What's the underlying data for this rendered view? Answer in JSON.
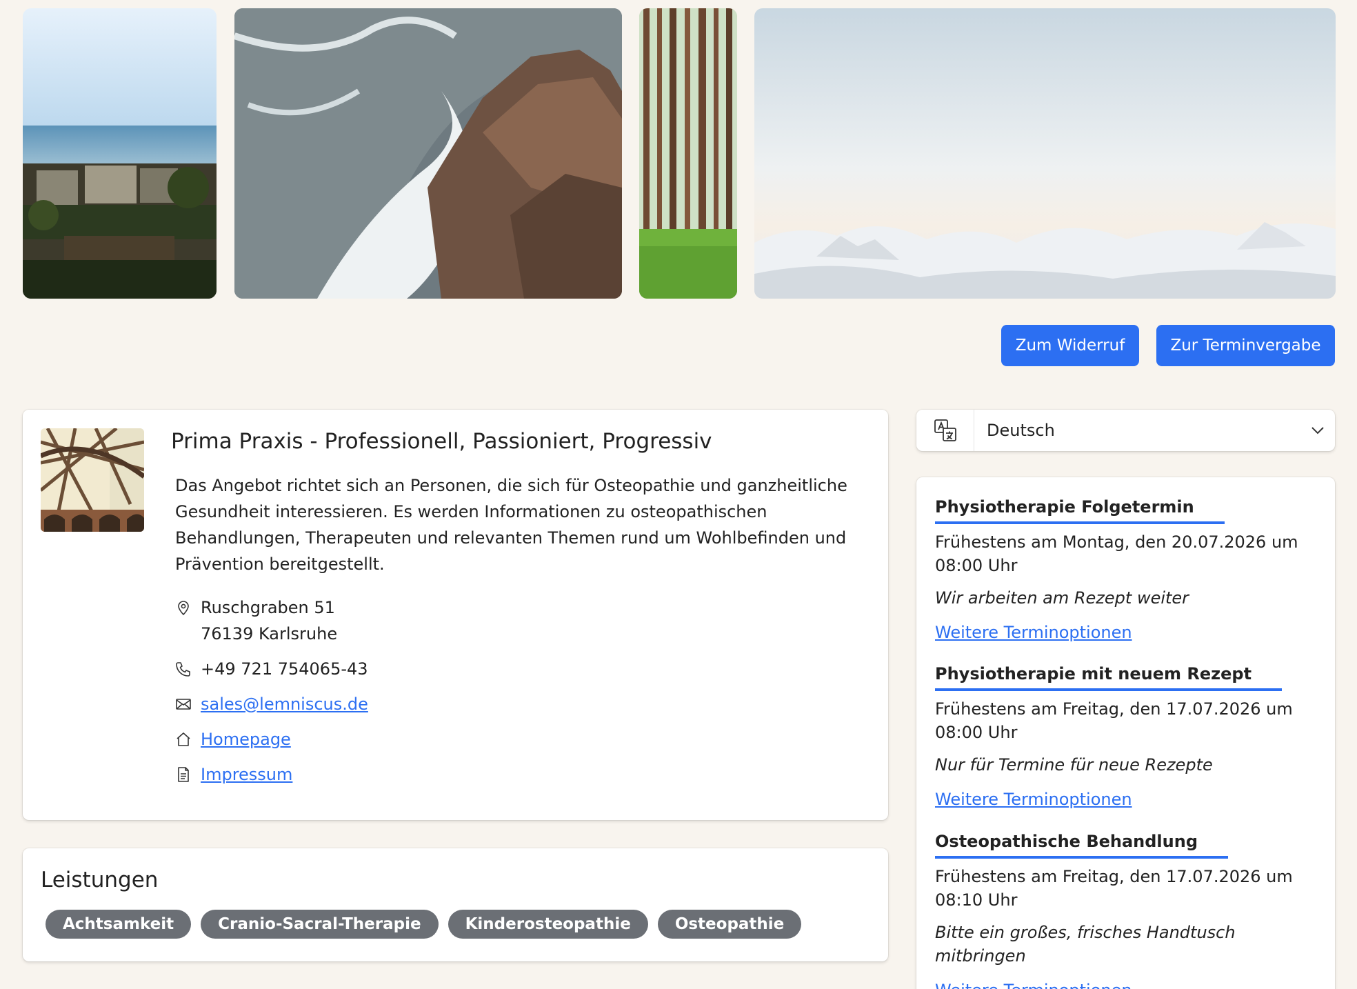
{
  "actions": {
    "widerruf_label": "Zum Widerruf",
    "termin_label": "Zur Terminvergabe"
  },
  "practice": {
    "title": "Prima Praxis - Professionell, Passioniert, Progressiv",
    "description": "Das Angebot richtet sich an Personen, die sich für Osteopathie und ganzheitliche Gesundheit interessieren. Es werden Informationen zu osteopathischen Behandlungen, Therapeuten und relevanten Themen rund um Wohlbefinden und Prävention bereitgestellt.",
    "address_street": "Ruschgraben 51",
    "address_city": "76139 Karlsruhe",
    "phone": "+49 721 754065-43",
    "email": "sales@lemniscus.de",
    "homepage_label": "Homepage",
    "imprint_label": "Impressum"
  },
  "services": {
    "title": "Leistungen",
    "tags": [
      "Achtsamkeit",
      "Cranio-Sacral-Therapie",
      "Kinderosteopathie",
      "Osteopathie"
    ]
  },
  "language": {
    "selected": "Deutsch"
  },
  "appointments": [
    {
      "title": "Physiotherapie Folgetermin",
      "when": "Frühestens am Montag, den 20.07.2026 um 08:00 Uhr",
      "note": "Wir arbeiten am Rezept weiter",
      "link": "Weitere Terminoptionen"
    },
    {
      "title": "Physiotherapie mit neuem Rezept",
      "when": "Frühestens am Freitag, den 17.07.2026 um 08:00 Uhr",
      "note": "Nur für Termine für neue Rezepte",
      "link": "Weitere Terminoptionen"
    },
    {
      "title": "Osteopathische Behandlung",
      "when": "Frühestens am Freitag, den 17.07.2026 um 08:10 Uhr",
      "note": "Bitte ein großes, frisches Handtusch mitbringen",
      "link": "Weitere Terminoptionen"
    }
  ],
  "colors": {
    "accent": "#2c6ff2",
    "page_background": "#f8f4ee",
    "tag_background": "#6b6f75"
  },
  "icons": [
    "location-pin-icon",
    "phone-icon",
    "mail-icon",
    "home-icon",
    "document-icon",
    "translate-icon",
    "chevron-down-icon"
  ]
}
